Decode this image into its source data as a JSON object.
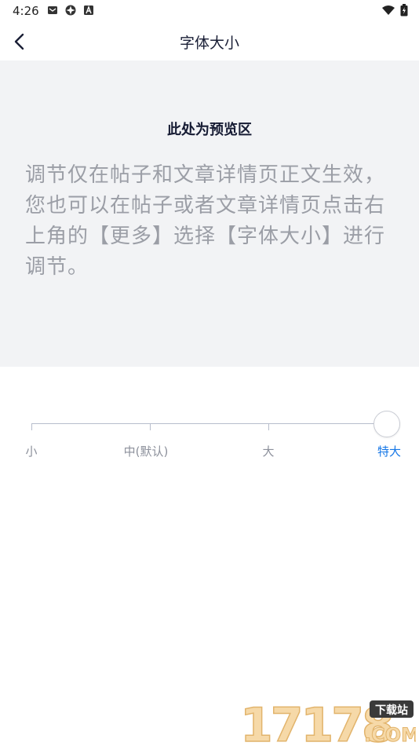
{
  "status_bar": {
    "time": "4:26",
    "left_icons": [
      "mail-icon",
      "app-icon",
      "a-icon"
    ],
    "right_icons": [
      "wifi-icon",
      "battery-icon"
    ]
  },
  "header": {
    "title": "字体大小"
  },
  "preview": {
    "heading": "此处为预览区",
    "body": "调节仅在帖子和文章详情页正文生效，您也可以在帖子或者文章详情页点击右上角的【更多】选择【字体大小】进行调节。"
  },
  "font_size_slider": {
    "options": [
      "小",
      "中(默认)",
      "大",
      "特大"
    ],
    "selected": "特大",
    "selected_index": 3
  },
  "watermark": {
    "digits": "17178",
    "badge": "下载站",
    "domain": ".COM"
  },
  "colors": {
    "accent": "#1677e6",
    "preview_bg": "#f2f3f5",
    "preview_text": "#9b9ea6",
    "title_text": "#1a1f36"
  }
}
